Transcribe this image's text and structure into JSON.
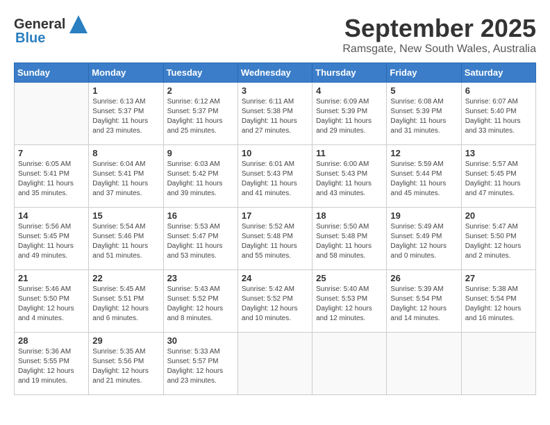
{
  "header": {
    "logo_general": "General",
    "logo_blue": "Blue",
    "month": "September 2025",
    "location": "Ramsgate, New South Wales, Australia"
  },
  "weekdays": [
    "Sunday",
    "Monday",
    "Tuesday",
    "Wednesday",
    "Thursday",
    "Friday",
    "Saturday"
  ],
  "weeks": [
    [
      {
        "day": "",
        "info": ""
      },
      {
        "day": "1",
        "info": "Sunrise: 6:13 AM\nSunset: 5:37 PM\nDaylight: 11 hours\nand 23 minutes."
      },
      {
        "day": "2",
        "info": "Sunrise: 6:12 AM\nSunset: 5:37 PM\nDaylight: 11 hours\nand 25 minutes."
      },
      {
        "day": "3",
        "info": "Sunrise: 6:11 AM\nSunset: 5:38 PM\nDaylight: 11 hours\nand 27 minutes."
      },
      {
        "day": "4",
        "info": "Sunrise: 6:09 AM\nSunset: 5:39 PM\nDaylight: 11 hours\nand 29 minutes."
      },
      {
        "day": "5",
        "info": "Sunrise: 6:08 AM\nSunset: 5:39 PM\nDaylight: 11 hours\nand 31 minutes."
      },
      {
        "day": "6",
        "info": "Sunrise: 6:07 AM\nSunset: 5:40 PM\nDaylight: 11 hours\nand 33 minutes."
      }
    ],
    [
      {
        "day": "7",
        "info": "Sunrise: 6:05 AM\nSunset: 5:41 PM\nDaylight: 11 hours\nand 35 minutes."
      },
      {
        "day": "8",
        "info": "Sunrise: 6:04 AM\nSunset: 5:41 PM\nDaylight: 11 hours\nand 37 minutes."
      },
      {
        "day": "9",
        "info": "Sunrise: 6:03 AM\nSunset: 5:42 PM\nDaylight: 11 hours\nand 39 minutes."
      },
      {
        "day": "10",
        "info": "Sunrise: 6:01 AM\nSunset: 5:43 PM\nDaylight: 11 hours\nand 41 minutes."
      },
      {
        "day": "11",
        "info": "Sunrise: 6:00 AM\nSunset: 5:43 PM\nDaylight: 11 hours\nand 43 minutes."
      },
      {
        "day": "12",
        "info": "Sunrise: 5:59 AM\nSunset: 5:44 PM\nDaylight: 11 hours\nand 45 minutes."
      },
      {
        "day": "13",
        "info": "Sunrise: 5:57 AM\nSunset: 5:45 PM\nDaylight: 11 hours\nand 47 minutes."
      }
    ],
    [
      {
        "day": "14",
        "info": "Sunrise: 5:56 AM\nSunset: 5:45 PM\nDaylight: 11 hours\nand 49 minutes."
      },
      {
        "day": "15",
        "info": "Sunrise: 5:54 AM\nSunset: 5:46 PM\nDaylight: 11 hours\nand 51 minutes."
      },
      {
        "day": "16",
        "info": "Sunrise: 5:53 AM\nSunset: 5:47 PM\nDaylight: 11 hours\nand 53 minutes."
      },
      {
        "day": "17",
        "info": "Sunrise: 5:52 AM\nSunset: 5:48 PM\nDaylight: 11 hours\nand 55 minutes."
      },
      {
        "day": "18",
        "info": "Sunrise: 5:50 AM\nSunset: 5:48 PM\nDaylight: 11 hours\nand 58 minutes."
      },
      {
        "day": "19",
        "info": "Sunrise: 5:49 AM\nSunset: 5:49 PM\nDaylight: 12 hours\nand 0 minutes."
      },
      {
        "day": "20",
        "info": "Sunrise: 5:47 AM\nSunset: 5:50 PM\nDaylight: 12 hours\nand 2 minutes."
      }
    ],
    [
      {
        "day": "21",
        "info": "Sunrise: 5:46 AM\nSunset: 5:50 PM\nDaylight: 12 hours\nand 4 minutes."
      },
      {
        "day": "22",
        "info": "Sunrise: 5:45 AM\nSunset: 5:51 PM\nDaylight: 12 hours\nand 6 minutes."
      },
      {
        "day": "23",
        "info": "Sunrise: 5:43 AM\nSunset: 5:52 PM\nDaylight: 12 hours\nand 8 minutes."
      },
      {
        "day": "24",
        "info": "Sunrise: 5:42 AM\nSunset: 5:52 PM\nDaylight: 12 hours\nand 10 minutes."
      },
      {
        "day": "25",
        "info": "Sunrise: 5:40 AM\nSunset: 5:53 PM\nDaylight: 12 hours\nand 12 minutes."
      },
      {
        "day": "26",
        "info": "Sunrise: 5:39 AM\nSunset: 5:54 PM\nDaylight: 12 hours\nand 14 minutes."
      },
      {
        "day": "27",
        "info": "Sunrise: 5:38 AM\nSunset: 5:54 PM\nDaylight: 12 hours\nand 16 minutes."
      }
    ],
    [
      {
        "day": "28",
        "info": "Sunrise: 5:36 AM\nSunset: 5:55 PM\nDaylight: 12 hours\nand 19 minutes."
      },
      {
        "day": "29",
        "info": "Sunrise: 5:35 AM\nSunset: 5:56 PM\nDaylight: 12 hours\nand 21 minutes."
      },
      {
        "day": "30",
        "info": "Sunrise: 5:33 AM\nSunset: 5:57 PM\nDaylight: 12 hours\nand 23 minutes."
      },
      {
        "day": "",
        "info": ""
      },
      {
        "day": "",
        "info": ""
      },
      {
        "day": "",
        "info": ""
      },
      {
        "day": "",
        "info": ""
      }
    ]
  ]
}
